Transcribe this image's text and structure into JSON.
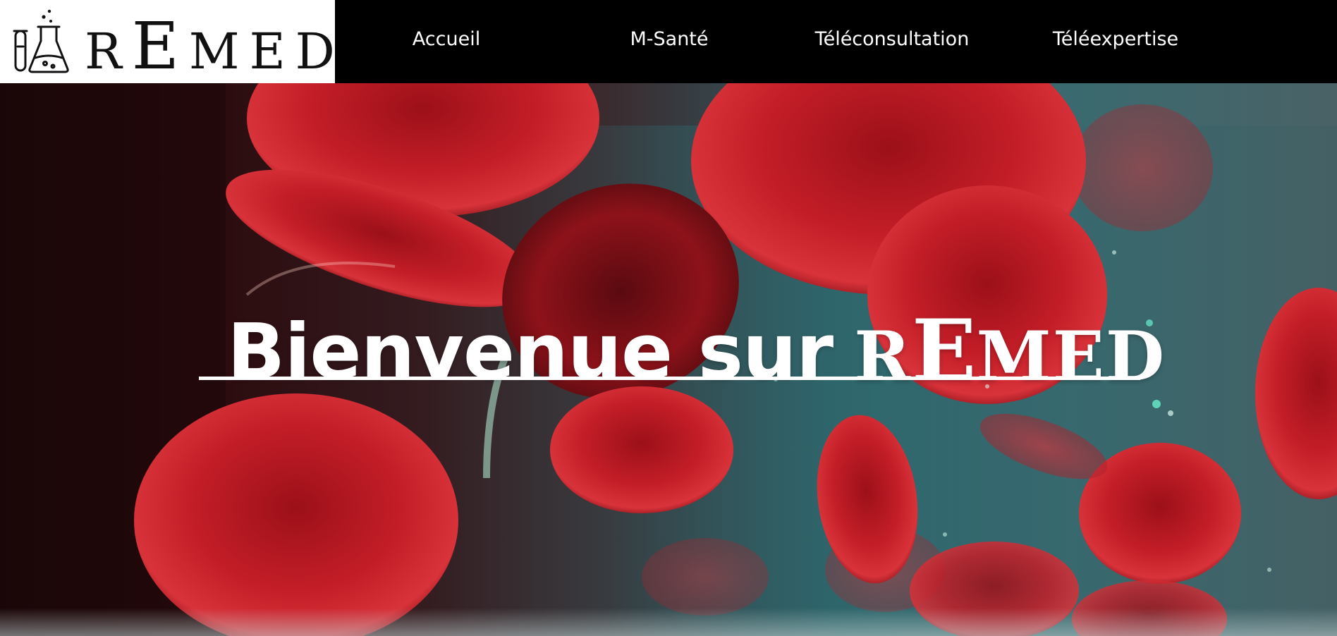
{
  "logo": {
    "icon": "flask-icon",
    "brand_initial": "R",
    "brand_big": "E",
    "brand_rest": "MED"
  },
  "nav": {
    "items": [
      {
        "label": "Accueil"
      },
      {
        "label": "M-Santé"
      },
      {
        "label": "Téléconsultation"
      },
      {
        "label": "Téléexpertise"
      }
    ]
  },
  "hero": {
    "welcome": "Bienvenue sur",
    "brand_initial": "R",
    "brand_big": "E",
    "brand_rest": "MED"
  },
  "colors": {
    "header_bg": "#000000",
    "logo_bg": "#ffffff",
    "nav_text": "#ffffff",
    "hero_text": "#ffffff",
    "accent_red": "#c01a24"
  }
}
